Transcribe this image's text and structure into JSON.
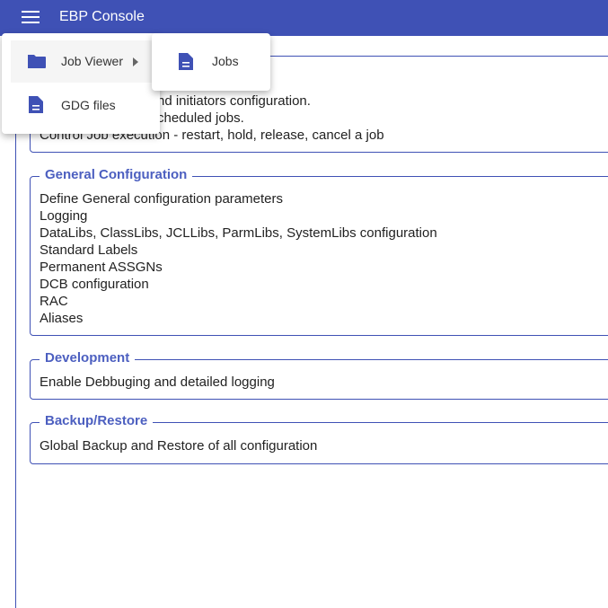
{
  "header": {
    "title": "EBP Console"
  },
  "sections": [
    {
      "legend": "",
      "lines": [
        "nd initiators configuration.",
        "cheduled jobs.",
        "Control Job execution - restart, hold, release, cancel a job"
      ]
    },
    {
      "legend": "General Configuration",
      "lines": [
        "Define General configuration parameters",
        "Logging",
        "DataLibs, ClassLibs, JCLLibs, ParmLibs, SystemLibs configuration",
        "Standard Labels",
        "Permanent ASSGNs",
        "DCB configuration",
        "RAC",
        "Aliases"
      ]
    },
    {
      "legend": "Development",
      "lines": [
        "Enable Debbuging and detailed logging"
      ]
    },
    {
      "legend": "Backup/Restore",
      "lines": [
        "Global Backup and Restore of all configuration"
      ]
    }
  ],
  "menu": {
    "items": [
      {
        "label": "Job Viewer",
        "icon": "folder-icon"
      },
      {
        "label": "GDG files",
        "icon": "file-icon"
      }
    ],
    "submenu": [
      {
        "label": "Jobs",
        "icon": "file-icon"
      }
    ]
  },
  "colors": {
    "primary": "#3f51b5"
  }
}
